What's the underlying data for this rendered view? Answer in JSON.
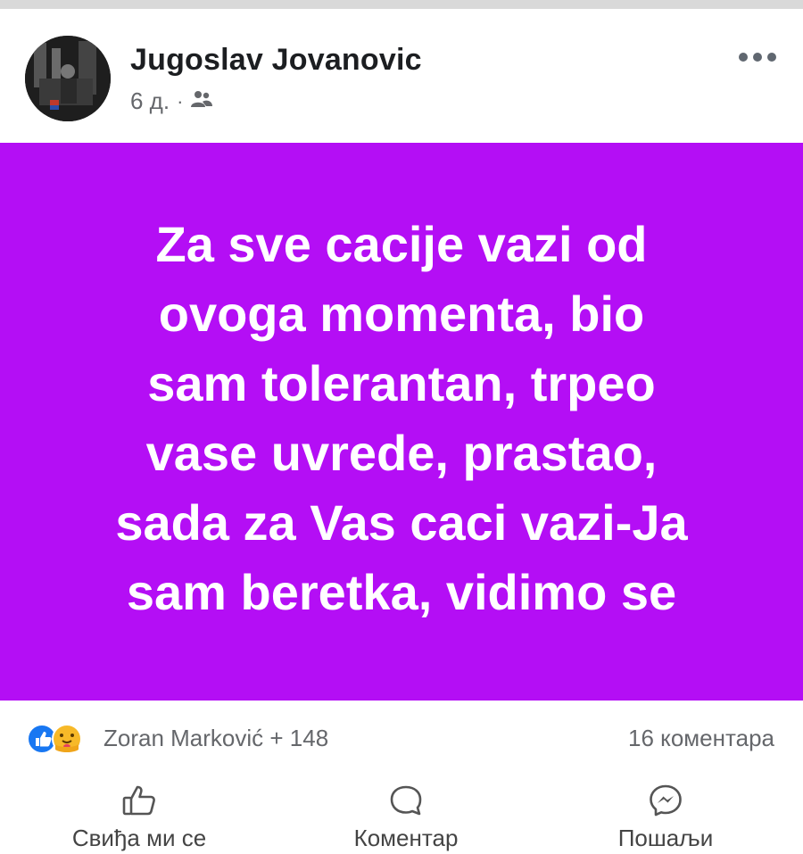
{
  "author": {
    "name": "Jugoslav Jovanovic"
  },
  "meta": {
    "time": "6 д.",
    "separator": "·",
    "audience_icon": "friends-icon"
  },
  "more_icon": "more-options-icon",
  "post": {
    "background_color": "#b40ef5",
    "text": "Za sve cacije vazi od\novoga momenta, bio\nsam tolerantan, trpeo\nvase uvrede, prastao,\nsada za Vas caci vazi-Ja\nsam beretka, vidimo se"
  },
  "reactions": {
    "icons": [
      "like-reaction-icon",
      "care-reaction-icon"
    ],
    "summary": "Zoran Marković + 148",
    "comments": "16 коментара"
  },
  "actions": [
    {
      "icon": "thumbs-up-icon",
      "label": "Свиђа ми се"
    },
    {
      "icon": "comment-icon",
      "label": "Коментар"
    },
    {
      "icon": "messenger-icon",
      "label": "Пошаљи"
    }
  ]
}
